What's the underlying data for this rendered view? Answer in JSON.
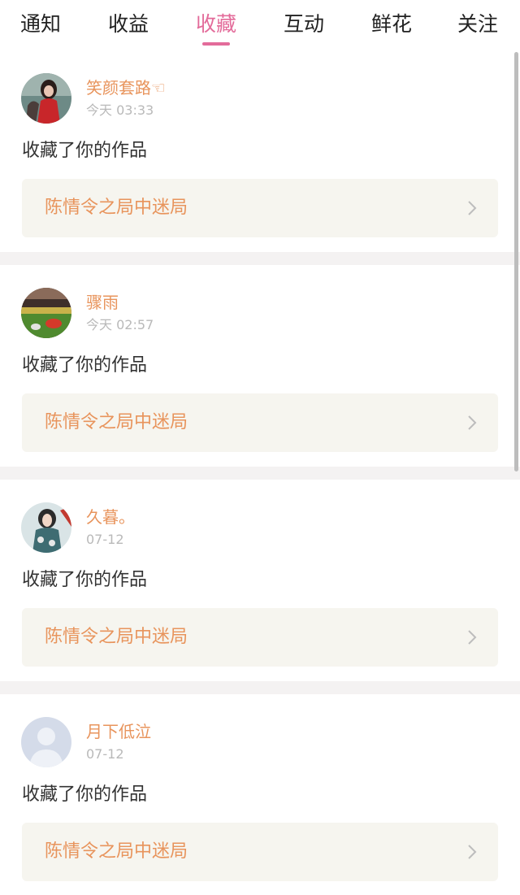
{
  "tabs": [
    {
      "label": "通知"
    },
    {
      "label": "收益"
    },
    {
      "label": "收藏",
      "active": true
    },
    {
      "label": "互动"
    },
    {
      "label": "鲜花"
    },
    {
      "label": "关注"
    }
  ],
  "accent_color": "#e36b9a",
  "name_color": "#e8945c",
  "feed": [
    {
      "username": "笑颜套路☜",
      "time": "今天 03:33",
      "action": "收藏了你的作品",
      "work": "陈情令之局中迷局",
      "avatar": "avatar-girl-red-dress"
    },
    {
      "username": "骤雨",
      "time": "今天 02:57",
      "action": "收藏了你的作品",
      "work": "陈情令之局中迷局",
      "avatar": "avatar-sports-field"
    },
    {
      "username": "久暮。",
      "time": "07-12",
      "action": "收藏了你的作品",
      "work": "陈情令之局中迷局",
      "avatar": "avatar-girl-costume"
    },
    {
      "username": "月下低泣",
      "time": "07-12",
      "action": "收藏了你的作品",
      "work": "陈情令之局中迷局",
      "avatar": "avatar-default-person"
    }
  ]
}
